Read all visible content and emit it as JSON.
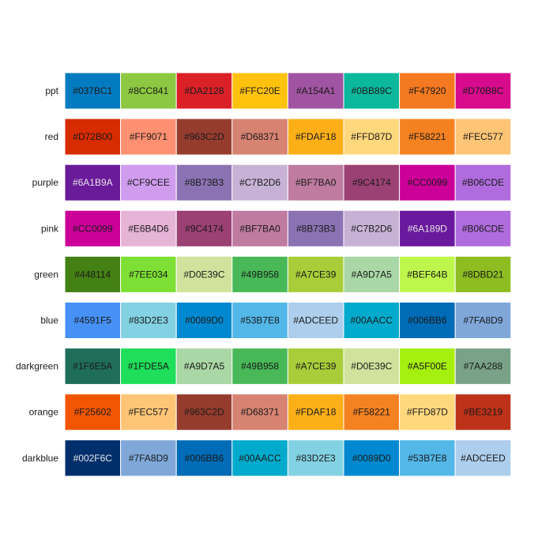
{
  "chart_data": {
    "type": "heatmap",
    "title": "",
    "xlabel": "",
    "ylabel": "",
    "rows": [
      {
        "name": "ppt",
        "colors": [
          "#037BC1",
          "#8CC841",
          "#DA2128",
          "#FFC20E",
          "#A154A1",
          "#0BB89C",
          "#F47920",
          "#D70B8C"
        ]
      },
      {
        "name": "red",
        "colors": [
          "#D72B00",
          "#FF9071",
          "#963C2D",
          "#D68371",
          "#FDAF18",
          "#FFD87D",
          "#F58221",
          "#FEC577"
        ]
      },
      {
        "name": "purple",
        "colors": [
          "#6A1B9A",
          "#CF9CEE",
          "#8B73B3",
          "#C7B2D6",
          "#BF7BA0",
          "#9C4174",
          "#CC0099",
          "#B06CDE"
        ]
      },
      {
        "name": "pink",
        "colors": [
          "#CC0099",
          "#E6B4D6",
          "#9C4174",
          "#BF7BA0",
          "#8B73B3",
          "#C7B2D6",
          "#6A189D",
          "#B06CDE"
        ]
      },
      {
        "name": "green",
        "colors": [
          "#448114",
          "#7EE034",
          "#D0E39C",
          "#49B958",
          "#A7CE39",
          "#A9D7A5",
          "#BEF64B",
          "#8DBD21"
        ]
      },
      {
        "name": "blue",
        "colors": [
          "#4591F5",
          "#83D2E3",
          "#0089D0",
          "#53B7E8",
          "#ADCEED",
          "#00AACC",
          "#006BB6",
          "#7FA8D9"
        ]
      },
      {
        "name": "darkgreen",
        "colors": [
          "#1F6E5A",
          "#1FDE5A",
          "#A9D7A5",
          "#49B958",
          "#A7CE39",
          "#D0E39C",
          "#A5F00E",
          "#7AA288"
        ]
      },
      {
        "name": "orange",
        "colors": [
          "#F25602",
          "#FEC577",
          "#963C2D",
          "#D68371",
          "#FDAF18",
          "#F58221",
          "#FFD87D",
          "#BE3219"
        ]
      },
      {
        "name": "darkblue",
        "colors": [
          "#002F6C",
          "#7FA8D9",
          "#006BB6",
          "#00AACC",
          "#83D2E3",
          "#0089D0",
          "#53B7E8",
          "#ADCEED"
        ]
      }
    ]
  }
}
